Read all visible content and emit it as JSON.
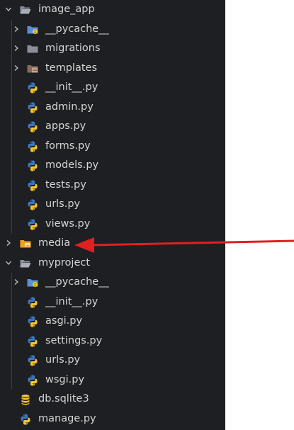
{
  "colors": {
    "background": "#1e1f22",
    "text": "#d4d4d4",
    "arrow": "#e02020",
    "folder_gray": "#8a8f98",
    "folder_media": "#f0a020",
    "python_blue": "#3b78c2",
    "python_yellow": "#f4c430",
    "db_yellow": "#f2c12e"
  },
  "tree": {
    "image_app": {
      "label": "image_app",
      "icon": "folder-open-icon",
      "expanded": true
    },
    "pycache_1": {
      "label": "__pycache__",
      "icon": "pycache-folder-icon"
    },
    "migrations": {
      "label": "migrations",
      "icon": "folder-icon"
    },
    "templates": {
      "label": "templates",
      "icon": "templates-folder-icon"
    },
    "init_1": {
      "label": "__init__.py",
      "icon": "python-file-icon"
    },
    "admin": {
      "label": "admin.py",
      "icon": "python-file-icon"
    },
    "apps": {
      "label": "apps.py",
      "icon": "python-file-icon"
    },
    "forms": {
      "label": "forms.py",
      "icon": "python-file-icon"
    },
    "models": {
      "label": "models.py",
      "icon": "python-file-icon"
    },
    "tests": {
      "label": "tests.py",
      "icon": "python-file-icon"
    },
    "urls_1": {
      "label": "urls.py",
      "icon": "python-file-icon"
    },
    "views": {
      "label": "views.py",
      "icon": "python-file-icon"
    },
    "media": {
      "label": "media",
      "icon": "media-folder-icon"
    },
    "myproject": {
      "label": "myproject",
      "icon": "folder-open-icon",
      "expanded": true
    },
    "pycache_2": {
      "label": "__pycache__",
      "icon": "pycache-folder-icon"
    },
    "init_2": {
      "label": "__init__.py",
      "icon": "python-file-icon"
    },
    "asgi": {
      "label": "asgi.py",
      "icon": "python-file-icon"
    },
    "settings": {
      "label": "settings.py",
      "icon": "python-file-icon"
    },
    "urls_2": {
      "label": "urls.py",
      "icon": "python-file-icon"
    },
    "wsgi": {
      "label": "wsgi.py",
      "icon": "python-file-icon"
    },
    "db": {
      "label": "db.sqlite3",
      "icon": "database-icon"
    },
    "manage": {
      "label": "manage.py",
      "icon": "python-file-icon"
    }
  },
  "annotation": {
    "icon": "red-arrow-icon"
  }
}
